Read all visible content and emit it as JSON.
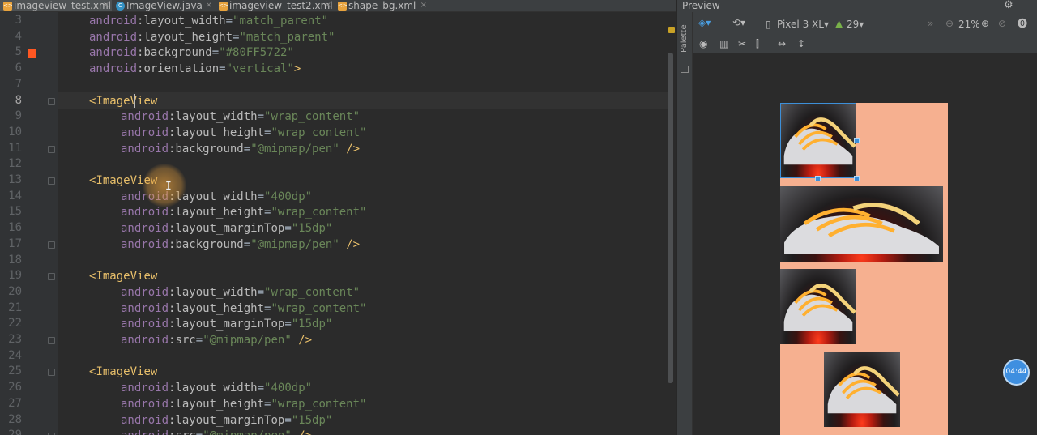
{
  "tabs": [
    {
      "label": "imageview_test.xml",
      "kind": "xml",
      "active": true
    },
    {
      "label": "ImageView.java",
      "kind": "java",
      "active": false
    },
    {
      "label": "imageview_test2.xml",
      "kind": "xml",
      "active": false
    },
    {
      "label": "shape_bg.xml",
      "kind": "xml",
      "active": false
    }
  ],
  "editor": {
    "current_line": 8,
    "lines": [
      {
        "n": "3",
        "indent": 1,
        "attr": "layout_width",
        "value": "\"match_parent\"",
        "end": ""
      },
      {
        "n": "4",
        "indent": 1,
        "attr": "layout_height",
        "value": "\"match_parent\"",
        "end": ""
      },
      {
        "n": "5",
        "indent": 1,
        "attr": "background",
        "value": "\"#80FF5722\"",
        "end": ""
      },
      {
        "n": "6",
        "indent": 1,
        "attr": "orientation",
        "value": "\"vertical\"",
        "end": ">"
      },
      {
        "n": "7",
        "indent": 0,
        "blank": true
      },
      {
        "n": "8",
        "indent": 0,
        "tag": "ImageView"
      },
      {
        "n": "9",
        "indent": 2,
        "attr": "layout_width",
        "value": "\"wrap_content\"",
        "end": ""
      },
      {
        "n": "10",
        "indent": 2,
        "attr": "layout_height",
        "value": "\"wrap_content\"",
        "end": ""
      },
      {
        "n": "11",
        "indent": 2,
        "attr": "background",
        "value": "\"@mipmap/pen\"",
        "end": " />"
      },
      {
        "n": "12",
        "indent": 0,
        "blank": true
      },
      {
        "n": "13",
        "indent": 0,
        "tag": "ImageView"
      },
      {
        "n": "14",
        "indent": 2,
        "attr": "layout_width",
        "value": "\"400dp\"",
        "end": ""
      },
      {
        "n": "15",
        "indent": 2,
        "attr": "layout_height",
        "value": "\"wrap_content\"",
        "end": ""
      },
      {
        "n": "16",
        "indent": 2,
        "attr": "layout_marginTop",
        "value": "\"15dp\"",
        "end": ""
      },
      {
        "n": "17",
        "indent": 2,
        "attr": "background",
        "value": "\"@mipmap/pen\"",
        "end": " />"
      },
      {
        "n": "18",
        "indent": 0,
        "blank": true
      },
      {
        "n": "19",
        "indent": 0,
        "tag": "ImageView"
      },
      {
        "n": "20",
        "indent": 2,
        "attr": "layout_width",
        "value": "\"wrap_content\"",
        "end": ""
      },
      {
        "n": "21",
        "indent": 2,
        "attr": "layout_height",
        "value": "\"wrap_content\"",
        "end": ""
      },
      {
        "n": "22",
        "indent": 2,
        "attr": "layout_marginTop",
        "value": "\"15dp\"",
        "end": ""
      },
      {
        "n": "23",
        "indent": 2,
        "attr": "src",
        "value": "\"@mipmap/pen\"",
        "end": " />"
      },
      {
        "n": "24",
        "indent": 0,
        "blank": true
      },
      {
        "n": "25",
        "indent": 0,
        "tag": "ImageView"
      },
      {
        "n": "26",
        "indent": 2,
        "attr": "layout_width",
        "value": "\"400dp\"",
        "end": ""
      },
      {
        "n": "27",
        "indent": 2,
        "attr": "layout_height",
        "value": "\"wrap_content\"",
        "end": ""
      },
      {
        "n": "28",
        "indent": 2,
        "attr": "layout_marginTop",
        "value": "\"15dp\"",
        "end": ""
      },
      {
        "n": "29",
        "indent": 2,
        "attr": "src",
        "value": "\"@mipmap/pen\"",
        "end": " />"
      }
    ],
    "namespace": "android",
    "colors": {
      "namespace": "#9876aa",
      "attribute": "#bababa",
      "value": "#6a8759",
      "tag": "#e8bf6a",
      "text": "#a9b7c6",
      "background": "#2b2b2b"
    }
  },
  "preview": {
    "title": "Preview",
    "palette_label": "Palette",
    "device": "Pixel 3 XL",
    "api_level": "29",
    "zoom": "21%",
    "layout_background": "#80FF5722",
    "timer": "04:44"
  }
}
